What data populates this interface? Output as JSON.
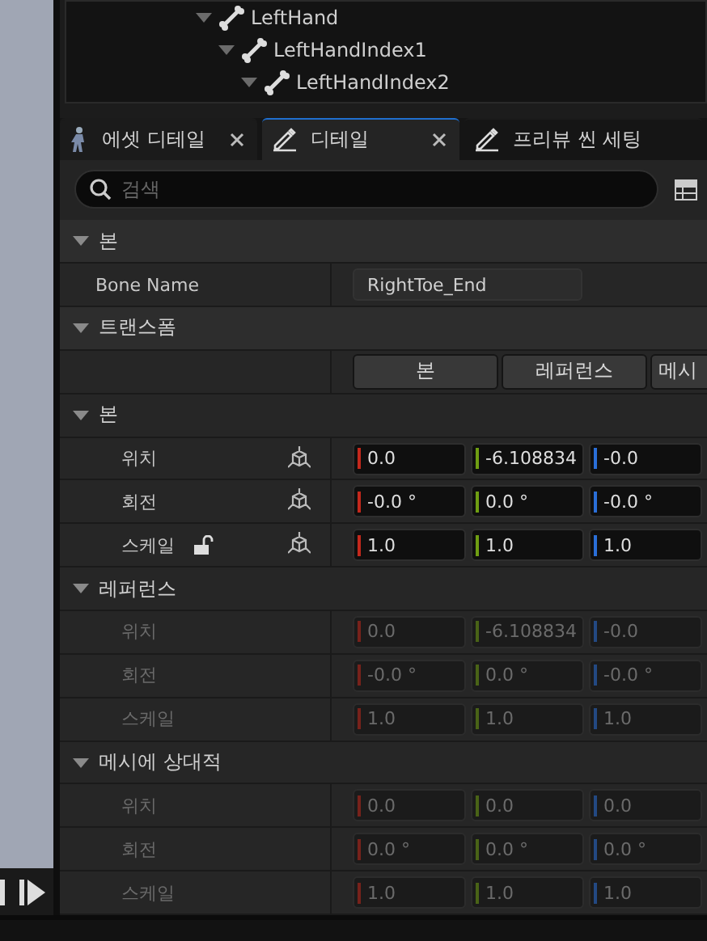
{
  "tree": [
    {
      "label": "LeftHand",
      "expanded": true,
      "children": [
        {
          "label": "LeftHandIndex1",
          "expanded": true,
          "children": [
            {
              "label": "LeftHandIndex2",
              "expanded": true
            }
          ]
        }
      ]
    }
  ],
  "tabs": [
    {
      "label": "에셋 디테일",
      "kind": "figure",
      "closable": true,
      "selected": false
    },
    {
      "label": "디테일",
      "kind": "pencil",
      "closable": true,
      "selected": true
    },
    {
      "label": "프리뷰 씬 세팅",
      "kind": "pencil",
      "closable": false,
      "selected": false
    }
  ],
  "search": {
    "placeholder": "검색"
  },
  "bone_section": {
    "title": "본",
    "expanded": true,
    "label": "Bone Name",
    "value": "RightToe_End"
  },
  "transform_section": {
    "title": "트랜스폼",
    "expanded": true,
    "modes": [
      "본",
      "레퍼런스",
      "메시"
    ],
    "groups": [
      {
        "title": "본",
        "expanded": true,
        "disabled": false,
        "gizmo": true,
        "rows": [
          {
            "label": "위치",
            "lock": false,
            "values": [
              "0.0",
              "-6.108834",
              "-0.0"
            ]
          },
          {
            "label": "회전",
            "lock": false,
            "values": [
              "-0.0 °",
              "0.0 °",
              "-0.0 °"
            ]
          },
          {
            "label": "스케일",
            "lock": true,
            "values": [
              "1.0",
              "1.0",
              "1.0"
            ]
          }
        ]
      },
      {
        "title": "레퍼런스",
        "expanded": true,
        "disabled": true,
        "gizmo": false,
        "rows": [
          {
            "label": "위치",
            "lock": false,
            "values": [
              "0.0",
              "-6.108834",
              "-0.0"
            ]
          },
          {
            "label": "회전",
            "lock": false,
            "values": [
              "-0.0 °",
              "0.0 °",
              "-0.0 °"
            ]
          },
          {
            "label": "스케일",
            "lock": false,
            "values": [
              "1.0",
              "1.0",
              "1.0"
            ]
          }
        ]
      },
      {
        "title": "메시에 상대적",
        "expanded": true,
        "disabled": true,
        "gizmo": false,
        "rows": [
          {
            "label": "위치",
            "lock": false,
            "values": [
              "0.0",
              "0.0",
              "0.0"
            ]
          },
          {
            "label": "회전",
            "lock": false,
            "values": [
              "0.0 °",
              "0.0 °",
              "0.0 °"
            ]
          },
          {
            "label": "스케일",
            "lock": false,
            "values": [
              "1.0",
              "1.0",
              "1.0"
            ]
          }
        ]
      }
    ]
  }
}
